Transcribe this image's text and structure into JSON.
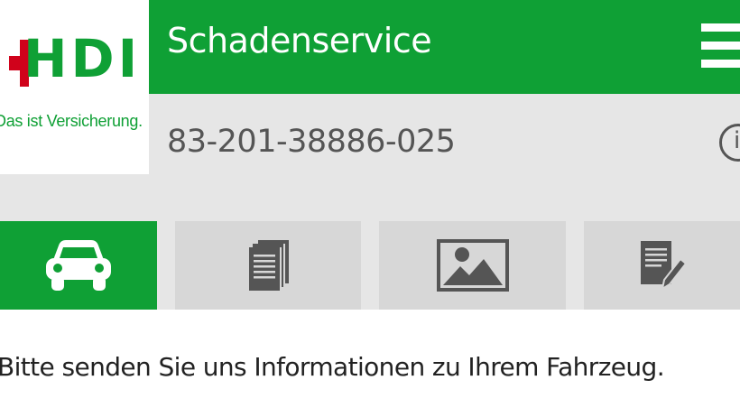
{
  "logo": {
    "brand": "HDI",
    "tagline": "Das ist Versicherung."
  },
  "header": {
    "title": "Schadenservice",
    "menu_icon": "hamburger-menu-icon"
  },
  "claim": {
    "number": "83-201-38886-025",
    "info_icon": "info-icon"
  },
  "tabs": [
    {
      "icon": "car-icon",
      "active": true
    },
    {
      "icon": "documents-icon",
      "active": false
    },
    {
      "icon": "image-icon",
      "active": false
    },
    {
      "icon": "note-pen-icon",
      "active": false
    }
  ],
  "content": {
    "instruction": "Bitte senden Sie uns Informationen zu Ihrem Fahrzeug."
  },
  "colors": {
    "brand_green": "#0fa035",
    "brand_red": "#d0021b",
    "tab_inactive": "#d7d7d7",
    "icon_dark": "#555555"
  }
}
